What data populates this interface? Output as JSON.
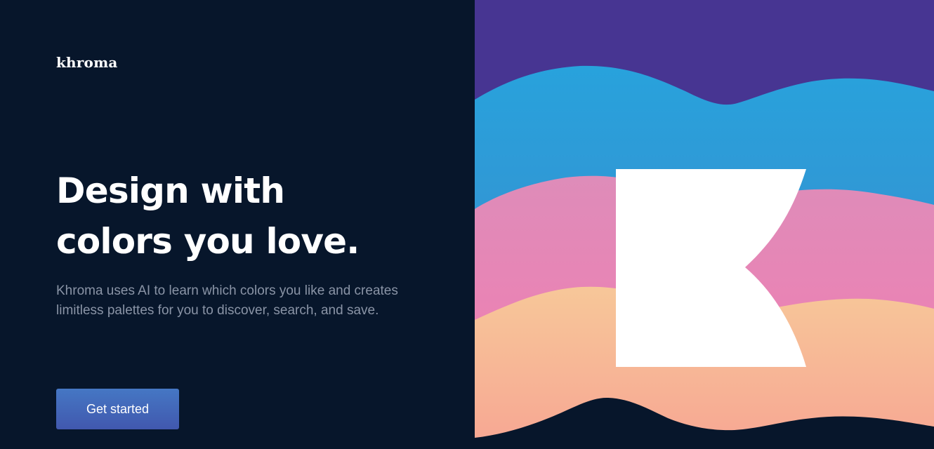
{
  "brand": {
    "logo_text": "khroma"
  },
  "hero": {
    "headline_line1": "Design with",
    "headline_line2": "colors you love.",
    "description": "Khroma uses AI to learn which colors you like and creates limitless palettes for you to discover, search, and save.",
    "cta_label": "Get started"
  },
  "colors": {
    "background": "#07162b",
    "band_purple": "#473592",
    "band_blue": "#2a9fdb",
    "band_pink": "#ee7db3",
    "band_peach": "#f7c297",
    "cta_top": "#4577c4",
    "cta_bottom": "#4158ae",
    "mark_white": "#ffffff"
  }
}
